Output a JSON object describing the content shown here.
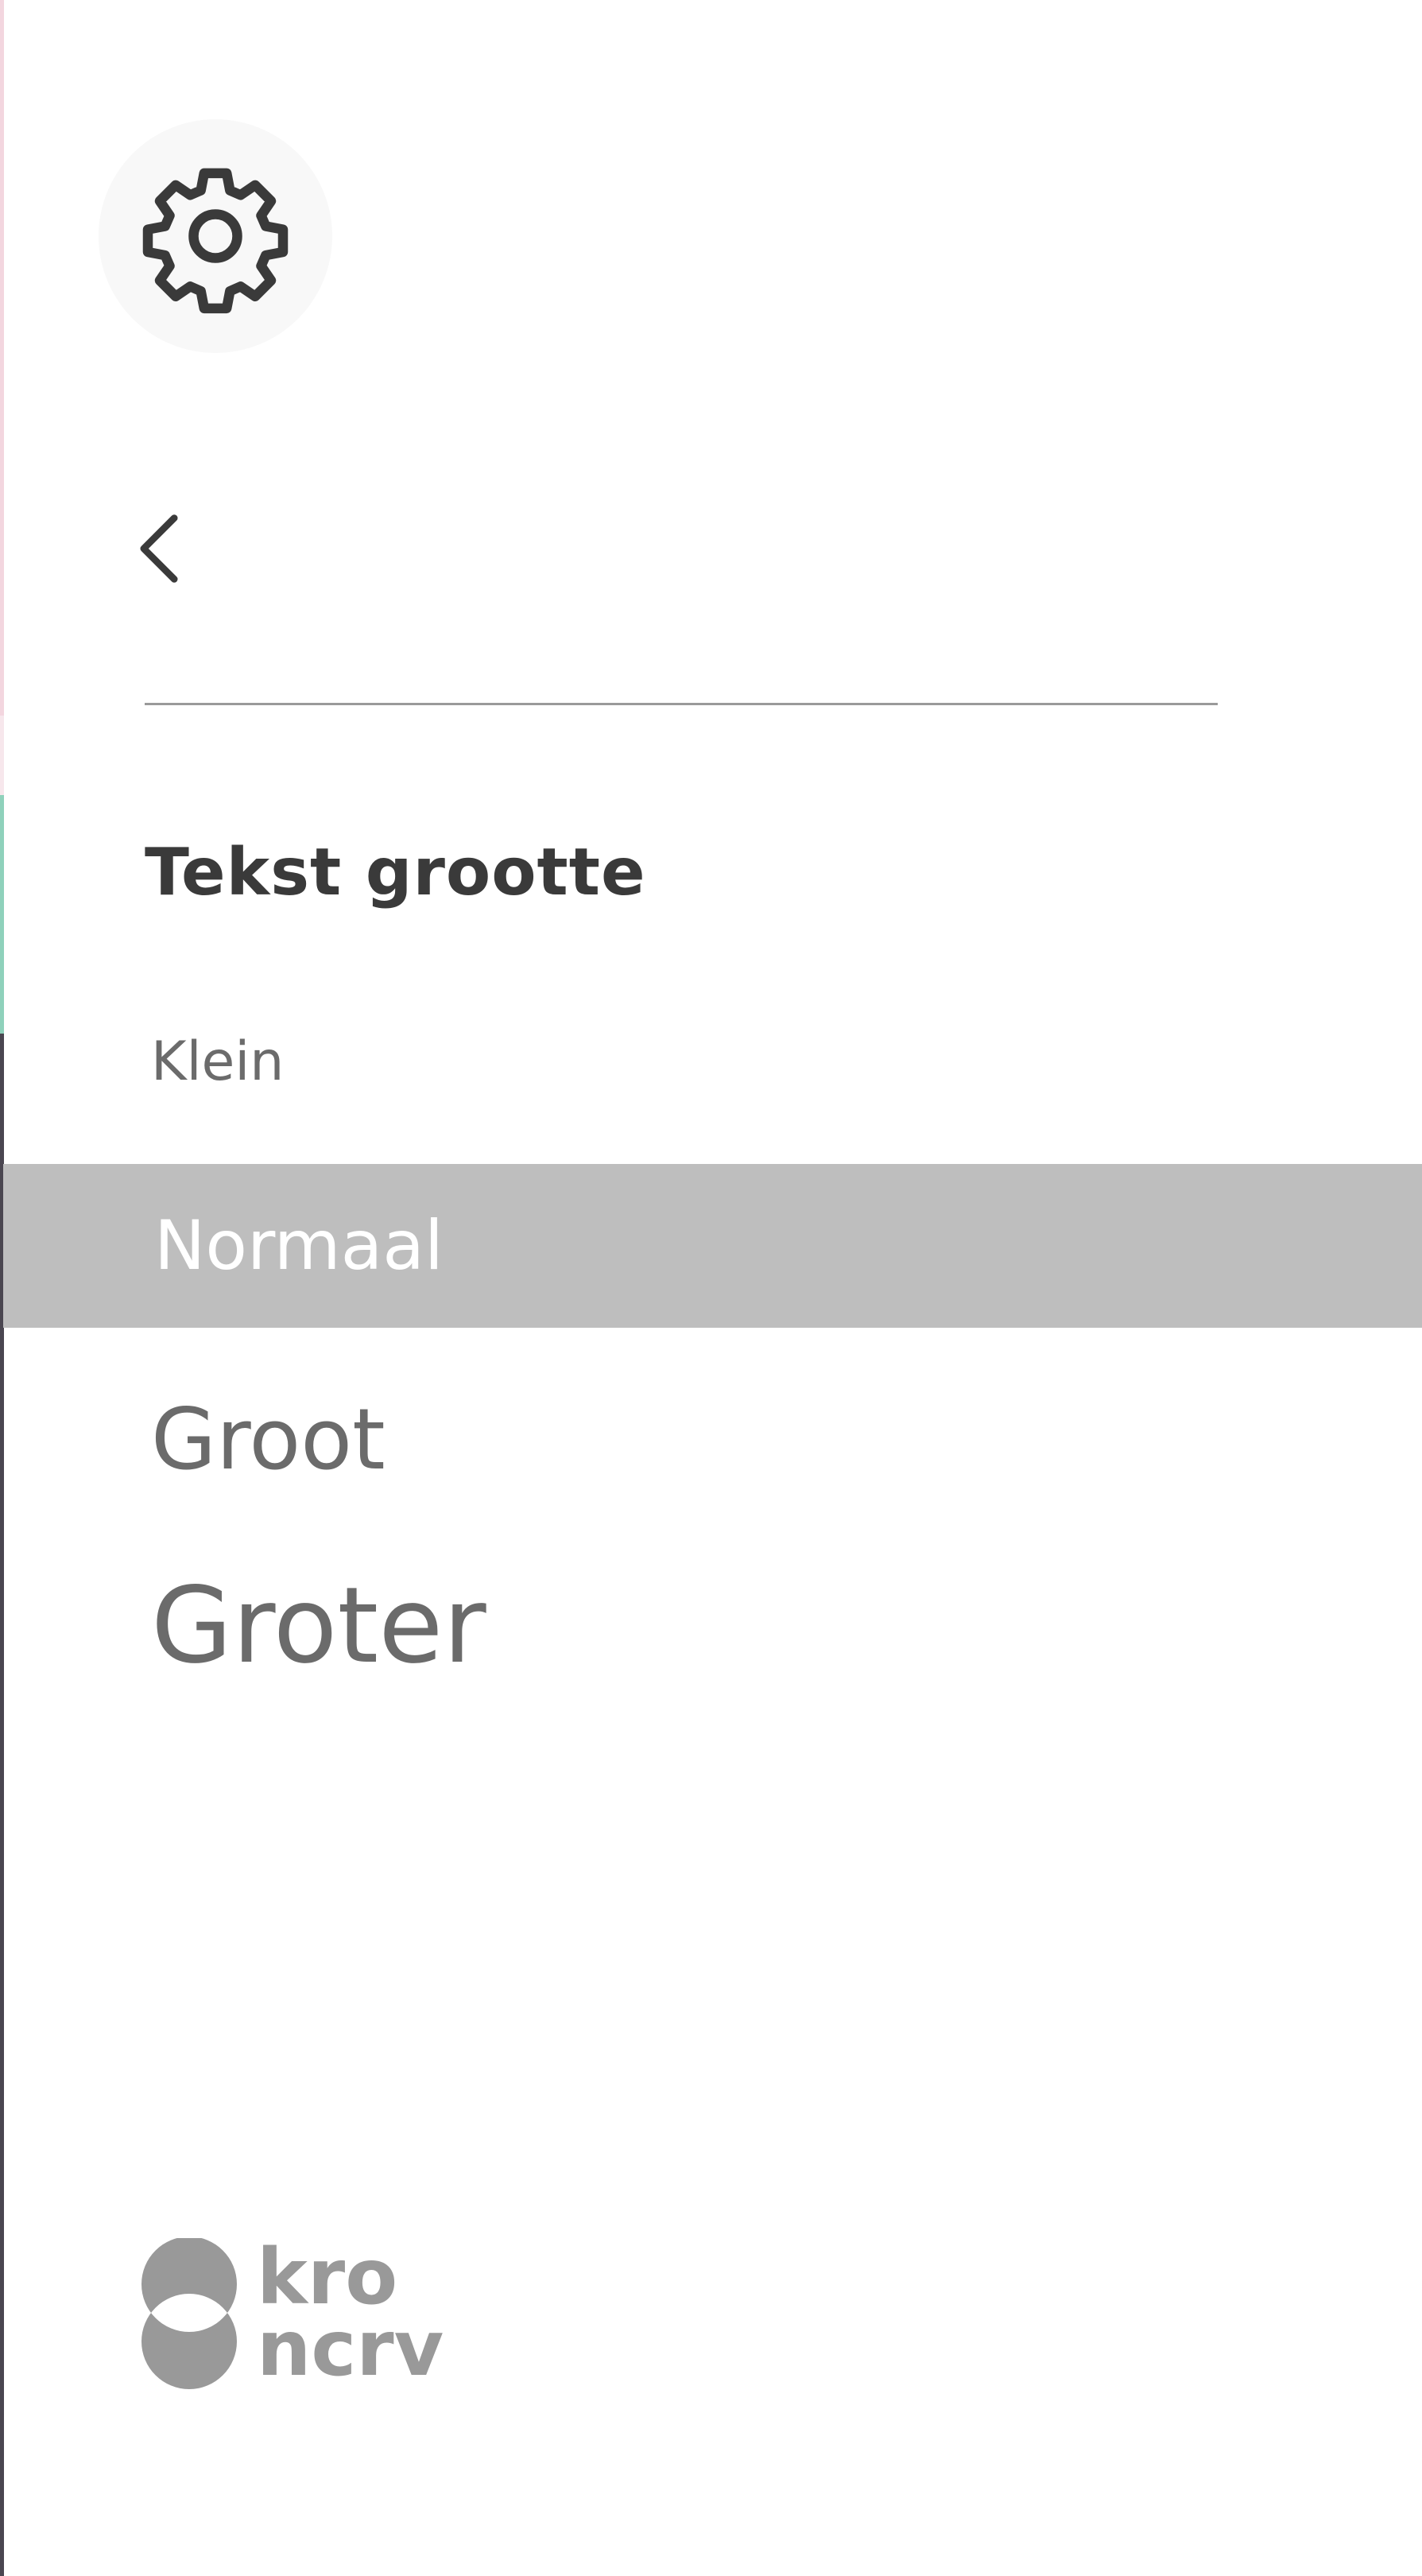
{
  "settings": {
    "icon": "gear-icon"
  },
  "navigation": {
    "back_icon": "chevron-left-icon"
  },
  "text_size": {
    "title": "Tekst grootte",
    "options": [
      {
        "label": "Klein",
        "selected": false
      },
      {
        "label": "Normaal",
        "selected": true
      },
      {
        "label": "Groot",
        "selected": false
      },
      {
        "label": "Groter",
        "selected": false
      }
    ]
  },
  "footer": {
    "logo_icon": "kro-ncrv-logo",
    "logo_text_line1": "kro",
    "logo_text_line2": "ncrv"
  },
  "colors": {
    "selected_bg": "#bebebe",
    "text_gray": "#6b6b6b",
    "title_dark": "#3a3a3a",
    "logo_gray": "#999999"
  }
}
